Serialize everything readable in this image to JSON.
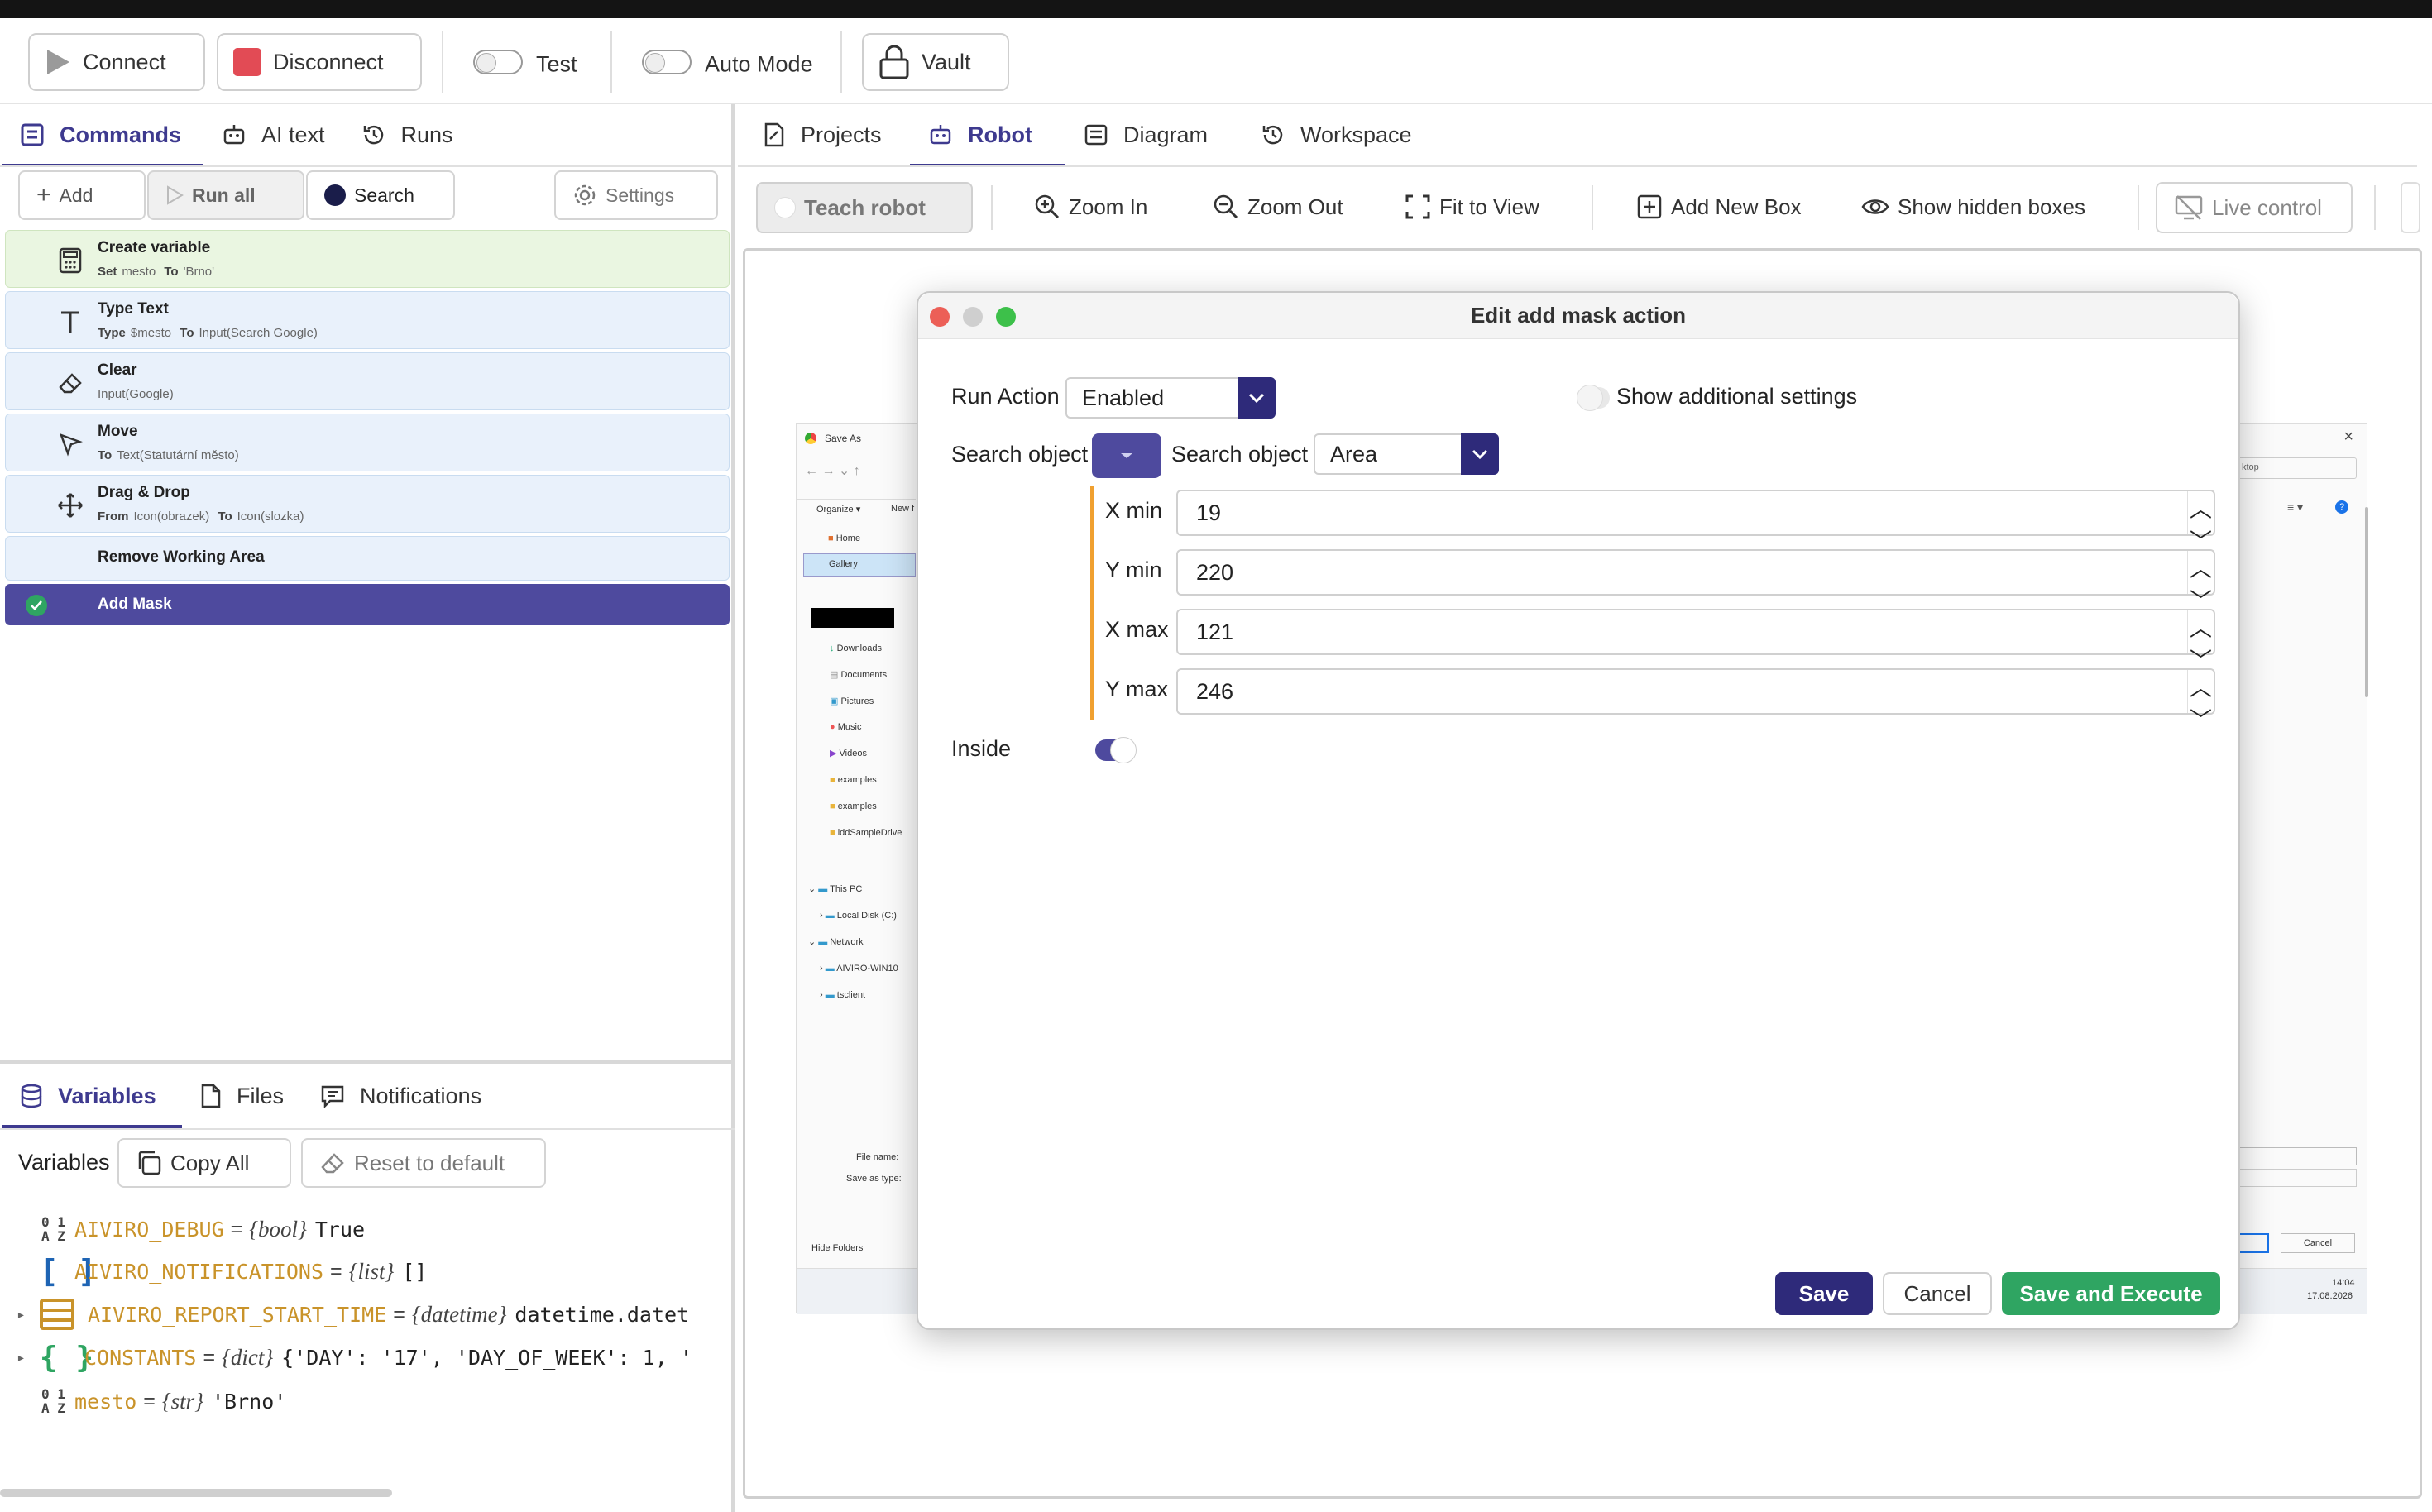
{
  "toolbar": {
    "connect_label": "Connect",
    "disconnect_label": "Disconnect",
    "test_label": "Test",
    "auto_mode_label": "Auto Mode",
    "vault_label": "Vault"
  },
  "left_tabs": [
    {
      "label": "Commands",
      "active": true,
      "icon": "commands-icon"
    },
    {
      "label": "AI text",
      "active": false,
      "icon": "robot-icon"
    },
    {
      "label": "Runs",
      "active": false,
      "icon": "history-icon"
    }
  ],
  "commands_toolbar": {
    "add_label": "Add",
    "run_all_label": "Run all",
    "search_label": "Search",
    "settings_label": "Settings"
  },
  "commands": [
    {
      "title": "Create variable",
      "sub_kw1": "Set",
      "sub_v1": "mesto",
      "sub_kw2": "To",
      "sub_v2": "'Brno'",
      "icon": "calculator-icon",
      "style": "green"
    },
    {
      "title": "Type Text",
      "sub_kw1": "Type",
      "sub_v1": "$mesto",
      "sub_kw2": "To",
      "sub_v2": "Input(Search Google)",
      "icon": "text-icon",
      "style": "blue"
    },
    {
      "title": "Clear",
      "sub_kw1": "",
      "sub_v1": "Input(Google)",
      "sub_kw2": "",
      "sub_v2": "",
      "icon": "eraser-icon",
      "style": "blue"
    },
    {
      "title": "Move",
      "sub_kw1": "To",
      "sub_v1": "Text(Statutární město)",
      "sub_kw2": "",
      "sub_v2": "",
      "icon": "cursor-icon",
      "style": "blue"
    },
    {
      "title": "Drag & Drop",
      "sub_kw1": "From",
      "sub_v1": "Icon(obrazek)",
      "sub_kw2": "To",
      "sub_v2": "Icon(slozka)",
      "icon": "move-icon",
      "style": "blue"
    },
    {
      "title": "Remove Working Area",
      "sub_kw1": "",
      "sub_v1": "",
      "sub_kw2": "",
      "sub_v2": "",
      "icon": "",
      "style": "blue"
    },
    {
      "title": "Add Mask",
      "sub_kw1": "",
      "sub_v1": "",
      "sub_kw2": "",
      "sub_v2": "",
      "icon": "check-icon",
      "style": "selected"
    }
  ],
  "bottom_tabs": [
    {
      "label": "Variables",
      "active": true,
      "icon": "database-icon"
    },
    {
      "label": "Files",
      "active": false,
      "icon": "file-icon"
    },
    {
      "label": "Notifications",
      "active": false,
      "icon": "message-icon"
    }
  ],
  "variables_toolbar": {
    "title": "Variables",
    "copy_all_label": "Copy All",
    "reset_label": "Reset to default"
  },
  "variables": [
    {
      "name": "AIVIRO_DEBUG",
      "type": "{bool}",
      "value": "True",
      "icon": "string-type-icon"
    },
    {
      "name": "AIVIRO_NOTIFICATIONS",
      "type": "{list}",
      "value": "[]",
      "icon": "list-type-icon"
    },
    {
      "name": "AIVIRO_REPORT_START_TIME",
      "type": "{datetime}",
      "value": "datetime.datet",
      "icon": "object-type-icon"
    },
    {
      "name": "CONSTANTS",
      "type": "{dict}",
      "value": "{'DAY': '17', 'DAY_OF_WEEK': 1, '",
      "icon": "dict-type-icon"
    },
    {
      "name": "mesto",
      "type": "{str}",
      "value": "'Brno'",
      "icon": "string-type-icon"
    }
  ],
  "right_tabs": [
    {
      "label": "Projects",
      "active": false,
      "icon": "projects-icon"
    },
    {
      "label": "Robot",
      "active": true,
      "icon": "robot-icon"
    },
    {
      "label": "Diagram",
      "active": false,
      "icon": "diagram-icon"
    },
    {
      "label": "Workspace",
      "active": false,
      "icon": "history-icon"
    }
  ],
  "robot_toolbar": {
    "teach_label": "Teach robot",
    "zoom_in_label": "Zoom In",
    "zoom_out_label": "Zoom Out",
    "fit_label": "Fit to View",
    "add_box_label": "Add New Box",
    "hidden_label": "Show hidden boxes",
    "live_label": "Live control"
  },
  "screenshot_preview": {
    "window_title": "Save As",
    "nav_items": [
      "Home",
      "Gallery",
      "Downloads",
      "Documents",
      "Pictures",
      "Music",
      "Videos",
      "examples",
      "examples",
      "lddSampleDrive",
      "This PC",
      "Local Disk (C:)",
      "Network",
      "AIVIRO-WIN10",
      "tsclient"
    ],
    "organize_label": "Organize ▾",
    "new_label": "New f",
    "search_label": "ktop",
    "file_name_label": "File name:",
    "save_as_type_label": "Save as type:",
    "hide_folders_label": "Hide Folders",
    "cancel_label": "Cancel",
    "time": "14:04",
    "date": "17.08.2026"
  },
  "dialog": {
    "title": "Edit add mask action",
    "run_action_label": "Run Action",
    "run_action_value": "Enabled",
    "show_additional_label": "Show additional settings",
    "search_object_label": "Search object",
    "search_object_label2": "Search object",
    "search_object_value": "Area",
    "x_min_label": "X min",
    "x_min_value": "19",
    "y_min_label": "Y min",
    "y_min_value": "220",
    "x_max_label": "X max",
    "x_max_value": "121",
    "y_max_label": "Y max",
    "y_max_value": "246",
    "inside_label": "Inside",
    "inside_on": true,
    "save_label": "Save",
    "cancel_label": "Cancel",
    "save_execute_label": "Save and Execute"
  },
  "colors": {
    "accent": "#3e3a8f",
    "dark_accent": "#2e2a7a",
    "green": "#2fa562",
    "orange_rule": "#f0a030",
    "variable_name": "#c9932a"
  }
}
